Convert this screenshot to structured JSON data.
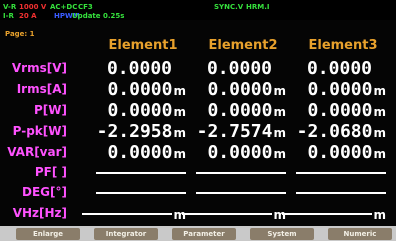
{
  "status": {
    "v_range": {
      "prefix": "V-R",
      "value": "1000 V"
    },
    "i_range": {
      "prefix": "I-R",
      "value": "20 A"
    },
    "coupling": "AC+DC",
    "crest_factor": "CF3",
    "sync": "SYNC.V",
    "harmonic": "HRM.I",
    "mode_tag": "HPWM",
    "update": "Update 0.25s"
  },
  "page_label": "Page: 1",
  "columns": [
    "Element1",
    "Element2",
    "Element3"
  ],
  "rows": [
    {
      "label": "Vrms[V]",
      "values": [
        {
          "v": "0.0000",
          "u": ""
        },
        {
          "v": "0.0000",
          "u": ""
        },
        {
          "v": "0.0000",
          "u": ""
        }
      ]
    },
    {
      "label": "Irms[A]",
      "values": [
        {
          "v": "0.0000",
          "u": "m"
        },
        {
          "v": "0.0000",
          "u": "m"
        },
        {
          "v": "0.0000",
          "u": "m"
        }
      ]
    },
    {
      "label": "P[W]",
      "values": [
        {
          "v": "0.0000",
          "u": "m"
        },
        {
          "v": "0.0000",
          "u": "m"
        },
        {
          "v": "0.0000",
          "u": "m"
        }
      ]
    },
    {
      "label": "P-pk[W]",
      "values": [
        {
          "v": "-2.2958",
          "u": "m"
        },
        {
          "v": "-2.7574",
          "u": "m"
        },
        {
          "v": "-2.0680",
          "u": "m"
        }
      ]
    },
    {
      "label": "VAR[var]",
      "values": [
        {
          "v": "0.0000",
          "u": "m"
        },
        {
          "v": "0.0000",
          "u": "m"
        },
        {
          "v": "0.0000",
          "u": "m"
        }
      ]
    },
    {
      "label": "PF[ ]",
      "values": [
        {
          "v": "",
          "u": ""
        },
        {
          "v": "",
          "u": ""
        },
        {
          "v": "",
          "u": ""
        }
      ]
    },
    {
      "label": "DEG[°]",
      "values": [
        {
          "v": "",
          "u": ""
        },
        {
          "v": "",
          "u": ""
        },
        {
          "v": "",
          "u": ""
        }
      ]
    },
    {
      "label": "VHz[Hz]",
      "values": [
        {
          "v": "",
          "u": "m"
        },
        {
          "v": "",
          "u": "m"
        },
        {
          "v": "",
          "u": "m"
        }
      ]
    }
  ],
  "softkeys": [
    "Enlarge",
    "Integrator",
    "Parameter",
    "System",
    "Numeric"
  ],
  "colors": {
    "label": "#ff52ff",
    "header": "#e8a12c",
    "value": "#ffffff",
    "status_green": "#35e03c",
    "status_red": "#f03030",
    "status_blue": "#3a5cff",
    "softkey": "#8a7d6a"
  }
}
